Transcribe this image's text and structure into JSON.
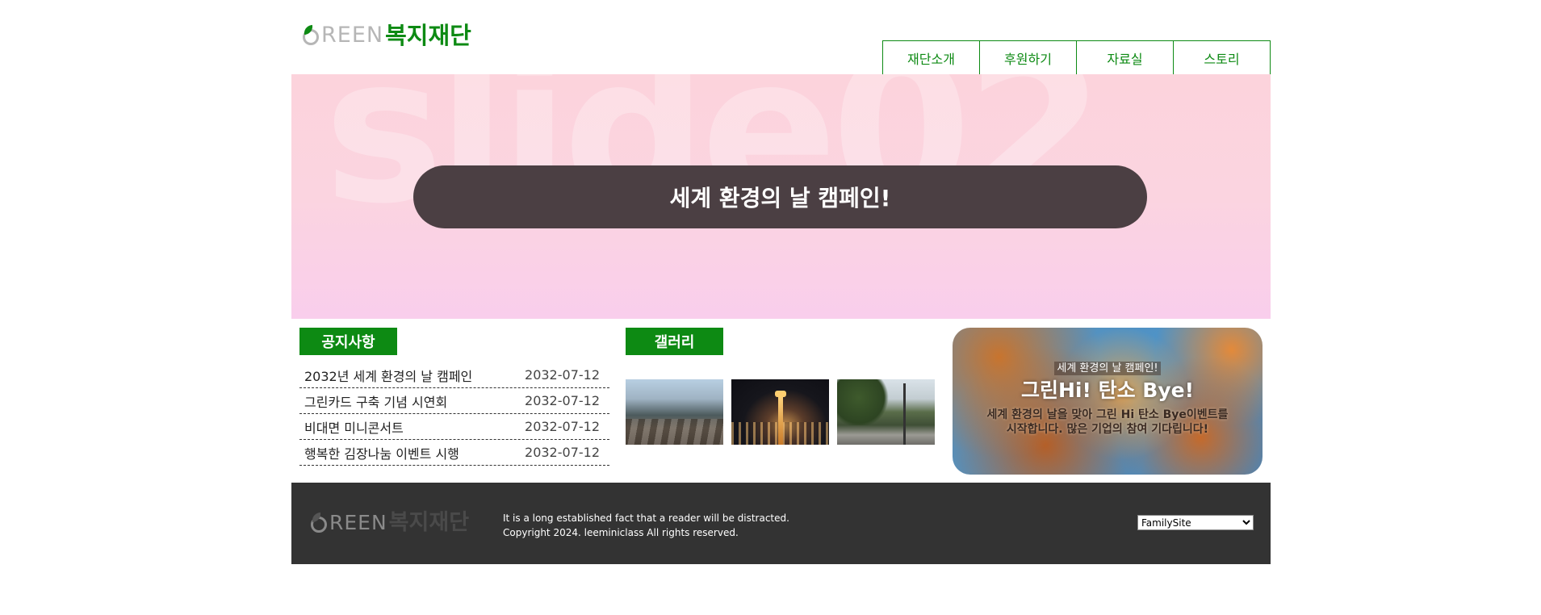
{
  "header": {
    "logo_green": "REEN",
    "logo_name": "복지재단",
    "nav": [
      "재단소개",
      "후원하기",
      "자료실",
      "스토리"
    ]
  },
  "slide": {
    "background_text": "slide02",
    "banner": "세계 환경의 날 캠페인!"
  },
  "notice": {
    "title": "공지사항",
    "items": [
      {
        "title": "2032년 세계 환경의 날 캠페인",
        "date": "2032-07-12"
      },
      {
        "title": "그린카드 구축 기념 시연회",
        "date": "2032-07-12"
      },
      {
        "title": "비대면 미니콘서트",
        "date": "2032-07-12"
      },
      {
        "title": "행복한 김장나눔 이벤트 시행",
        "date": "2032-07-12"
      }
    ]
  },
  "gallery": {
    "title": "갤러리"
  },
  "event": {
    "sub": "세계 환경의 날 캠페인!",
    "main": "그린Hi! 탄소 Bye!",
    "desc_line1": "세계 환경의 날을 맞아 그린 Hi 탄소 Bye이벤트를",
    "desc_line2": "시작합니다. 많은 기업의 참여 기다립니다!"
  },
  "footer": {
    "logo_green": "REEN",
    "logo_name": "복지재단",
    "line1": "It is a long established fact that a reader will be distracted.",
    "line2": "Copyright 2024. leeminiclass All rights reserved.",
    "family_select": "FamilySite"
  },
  "colors": {
    "brand_green": "#0d8a13",
    "banner": "#4b3f43",
    "footer_bg": "#333333"
  }
}
